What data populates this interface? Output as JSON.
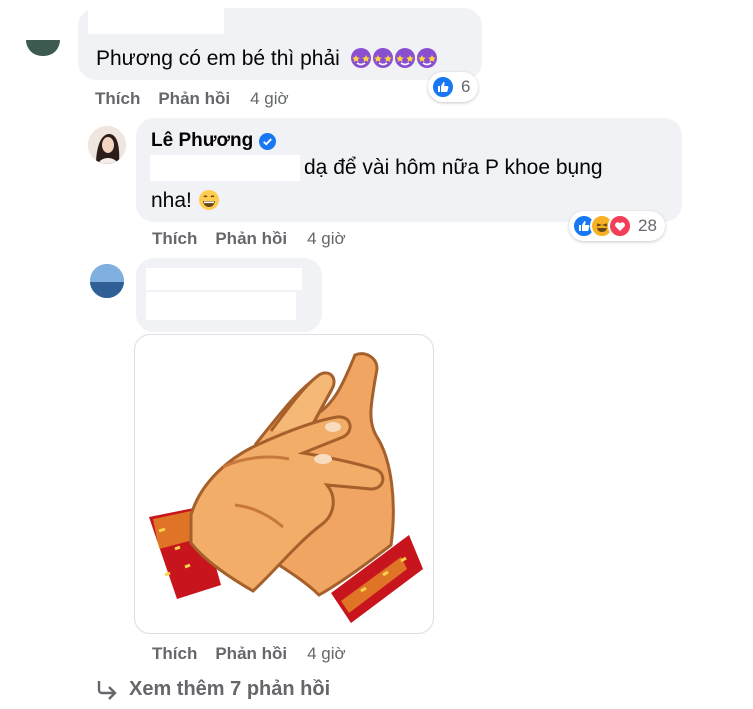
{
  "comments": [
    {
      "text": "Phương có em bé thì phải",
      "emoji_count": 4,
      "reactions": {
        "icons": [
          "like-icon"
        ],
        "count": "6"
      },
      "actions": {
        "like": "Thích",
        "reply": "Phản hồi",
        "time": "4 giờ"
      }
    },
    {
      "author": "Lê Phương",
      "verified": true,
      "text_line1": "dạ để vài hôm nữa P khoe bụng",
      "text_line2": "nha!",
      "reactions": {
        "icons": [
          "like-icon",
          "haha-icon",
          "love-icon"
        ],
        "count": "28"
      },
      "actions": {
        "like": "Thích",
        "reply": "Phản hồi",
        "time": "4 giờ"
      }
    },
    {
      "sticker": "clapping-hands-sticker",
      "actions": {
        "like": "Thích",
        "reply": "Phản hồi",
        "time": "4 giờ"
      }
    }
  ],
  "see_more": {
    "label": "Xem thêm 7 phản hồi",
    "icon": "reply-arrow-icon"
  },
  "colors": {
    "bubble": "#f0f2f5",
    "meta": "#65676b",
    "like": "#1877f2",
    "love": "#f33e58",
    "haha": "#f7b125"
  }
}
